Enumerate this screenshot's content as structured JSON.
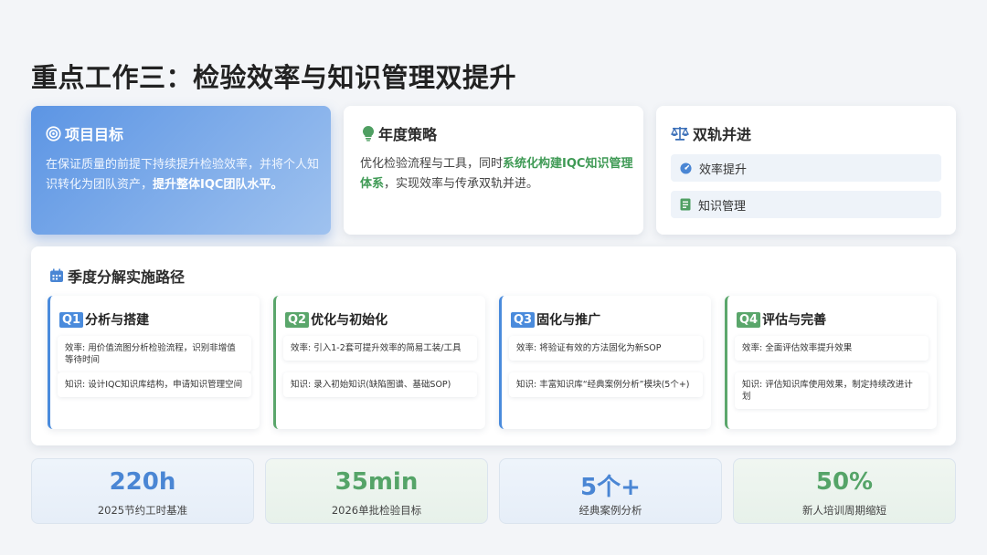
{
  "title": "重点工作三：检验效率与知识管理双提升",
  "goal": {
    "title": "项目目标",
    "text": "在保证质量的前提下持续提升检验效率，并将个人知识转化为团队资产，",
    "text_bold": "提升整体IQC团队水平。"
  },
  "strategy": {
    "title": "年度策略",
    "text_before": "优化检验流程与工具，同时",
    "text_highlight": "系统化构建IQC知识管理体系",
    "text_after": "，实现效率与传承双轨并进。"
  },
  "dual": {
    "title": "双轨并进",
    "items": [
      {
        "label": "效率提升",
        "icon": "gauge-icon"
      },
      {
        "label": "知识管理",
        "icon": "book-icon"
      }
    ]
  },
  "route": {
    "title": "季度分解实施路径",
    "quarters": [
      {
        "tag": "Q1",
        "title": "分析与搭建",
        "efficiency": "效率: 用价值流图分析检验流程，识别非增值等待时间",
        "knowledge": "知识: 设计IQC知识库结构，申请知识管理空间"
      },
      {
        "tag": "Q2",
        "title": "优化与初始化",
        "efficiency": "效率: 引入1-2套可提升效率的简易工装/工具",
        "knowledge": "知识: 录入初始知识(缺陷图谱、基础SOP)"
      },
      {
        "tag": "Q3",
        "title": "固化与推广",
        "efficiency": "效率: 将验证有效的方法固化为新SOP",
        "knowledge": "知识: 丰富知识库“经典案例分析”模块(5个+)"
      },
      {
        "tag": "Q4",
        "title": "评估与完善",
        "efficiency": "效率: 全面评估效率提升效果",
        "knowledge": "知识: 评估知识库使用效果，制定持续改进计划"
      }
    ]
  },
  "stats": [
    {
      "value": "220h",
      "label": "2025节约工时基准",
      "color": "#4a86d4"
    },
    {
      "value": "35min",
      "label": "2026单批检验目标",
      "color": "#55a468"
    },
    {
      "value": "5个+",
      "label": "经典案例分析",
      "color": "#4a86d4"
    },
    {
      "value": "50%",
      "label": "新人培训周期缩短",
      "color": "#55a468"
    }
  ]
}
